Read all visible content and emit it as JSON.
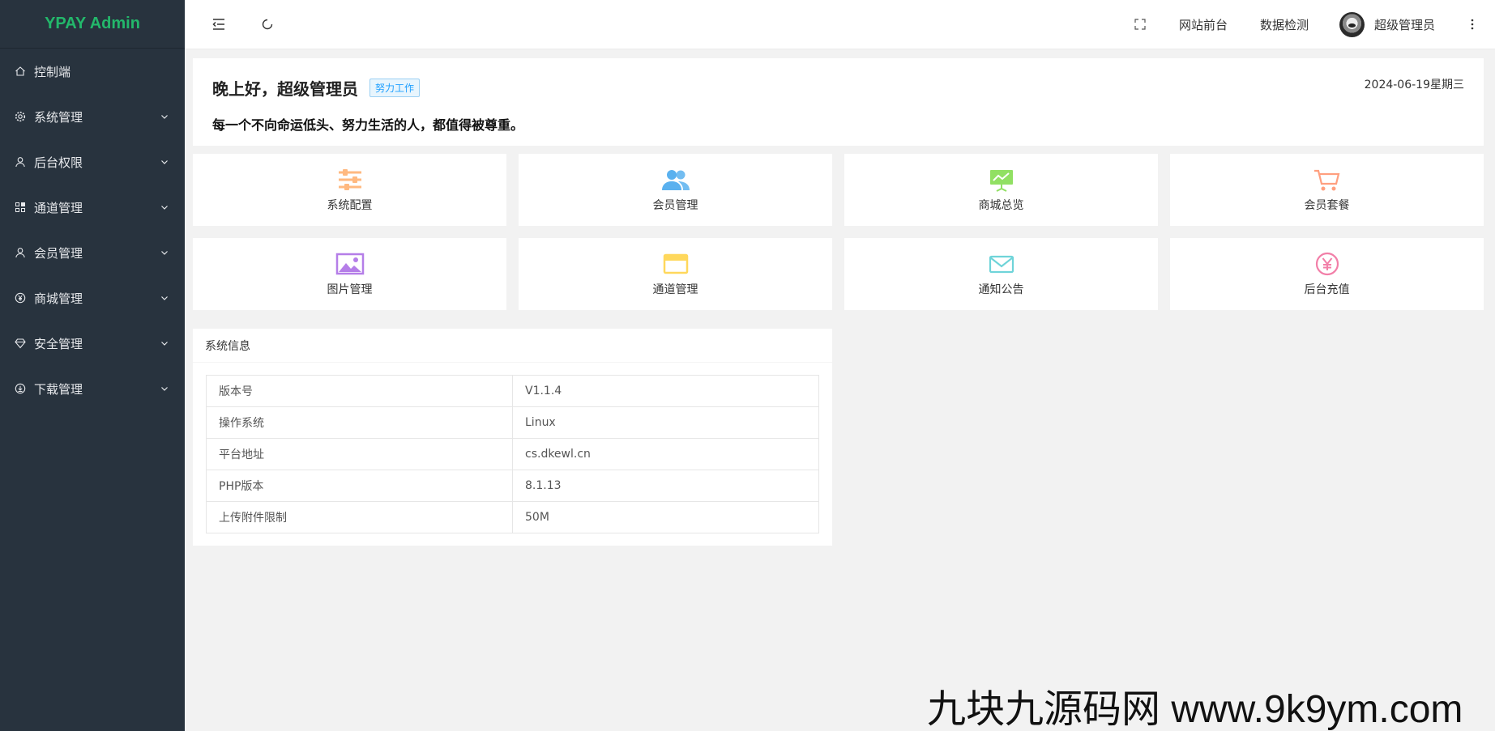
{
  "app": {
    "logo": "YPAY Admin"
  },
  "sidebar": {
    "items": [
      {
        "label": "控制端",
        "icon": "home-icon",
        "has_children": false
      },
      {
        "label": "系统管理",
        "icon": "gear-icon",
        "has_children": true
      },
      {
        "label": "后台权限",
        "icon": "user-icon",
        "has_children": true
      },
      {
        "label": "通道管理",
        "icon": "apps-icon",
        "has_children": true
      },
      {
        "label": "会员管理",
        "icon": "user-icon",
        "has_children": true
      },
      {
        "label": "商城管理",
        "icon": "yen-circle-icon",
        "has_children": true
      },
      {
        "label": "安全管理",
        "icon": "diamond-icon",
        "has_children": true
      },
      {
        "label": "下载管理",
        "icon": "download-circle-icon",
        "has_children": true
      }
    ]
  },
  "header": {
    "left_icons": [
      "menu-fold-icon",
      "refresh-icon"
    ],
    "fullscreen_icon": "fullscreen-icon",
    "links": [
      "网站前台",
      "数据检测"
    ],
    "user_name": "超级管理员",
    "more_icon": "more-vertical-icon"
  },
  "greeting": {
    "title": "晚上好，超级管理员",
    "tag": "努力工作",
    "date": "2024-06-19星期三",
    "motto": "每一个不向命运低头、努力生活的人，都值得被尊重。"
  },
  "quick_links": [
    {
      "label": "系统配置",
      "icon": "sliders-icon",
      "color": "#ffb980"
    },
    {
      "label": "会员管理",
      "icon": "users-icon",
      "color": "#5ab1ef"
    },
    {
      "label": "商城总览",
      "icon": "presentation-chart-icon",
      "color": "#91e063"
    },
    {
      "label": "会员套餐",
      "icon": "cart-icon",
      "color": "#ff9f7f"
    },
    {
      "label": "图片管理",
      "icon": "image-icon",
      "color": "#b57ee8"
    },
    {
      "label": "通道管理",
      "icon": "window-icon",
      "color": "#ffd85c"
    },
    {
      "label": "通知公告",
      "icon": "mail-icon",
      "color": "#6fd4d9"
    },
    {
      "label": "后台充值",
      "icon": "yen-circle-icon",
      "color": "#f27fa8"
    }
  ],
  "system_info": {
    "title": "系统信息",
    "rows": [
      {
        "key": "版本号",
        "value": "V1.1.4"
      },
      {
        "key": "操作系统",
        "value": "Linux"
      },
      {
        "key": "平台地址",
        "value": "cs.dkewl.cn"
      },
      {
        "key": "PHP版本",
        "value": "8.1.13"
      },
      {
        "key": "上传附件限制",
        "value": "50M"
      }
    ]
  },
  "watermark": "九块九源码网 www.9k9ym.com"
}
